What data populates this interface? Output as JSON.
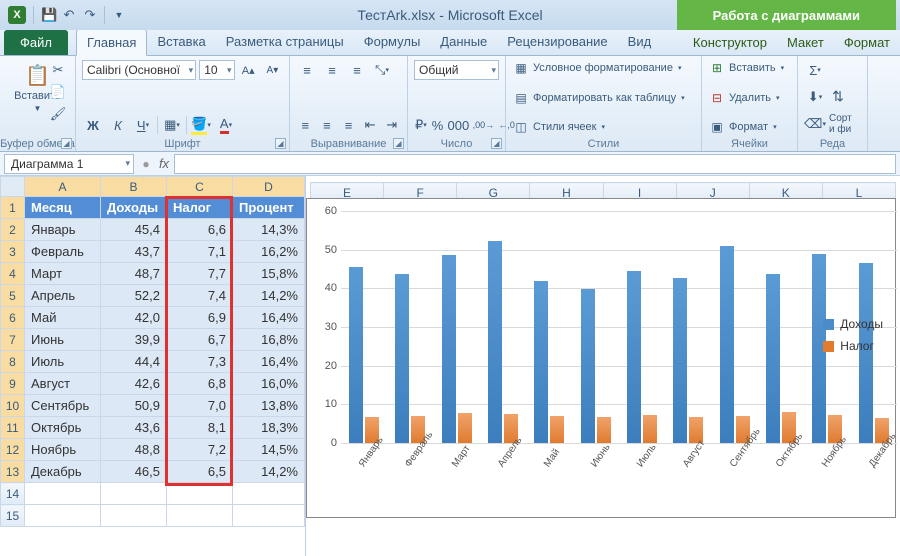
{
  "title": "ТестArk.xlsx - Microsoft Excel",
  "chart_tools_title": "Работа с диаграммами",
  "qat": {
    "save": "save",
    "undo": "undo",
    "redo": "redo"
  },
  "tabs": {
    "file": "Файл",
    "list": [
      "Главная",
      "Вставка",
      "Разметка страницы",
      "Формулы",
      "Данные",
      "Рецензирование",
      "Вид"
    ],
    "chart": [
      "Конструктор",
      "Макет",
      "Формат"
    ],
    "active": 0
  },
  "ribbon": {
    "clipboard": {
      "label": "Буфер обмена",
      "paste": "Вставить"
    },
    "font": {
      "label": "Шрифт",
      "name": "Calibri (Основної",
      "size": "10"
    },
    "align": {
      "label": "Выравнивание"
    },
    "number": {
      "label": "Число",
      "format": "Общий"
    },
    "styles": {
      "label": "Стили",
      "cond": "Условное форматирование",
      "table": "Форматировать как таблицу",
      "cell": "Стили ячеек"
    },
    "cells": {
      "label": "Ячейки",
      "insert": "Вставить",
      "delete": "Удалить",
      "format": "Формат"
    },
    "editing": {
      "label": "Реда",
      "sort": "Сорт\nи фи"
    }
  },
  "namebox": "Диаграмма 1",
  "columns": [
    "A",
    "B",
    "C",
    "D",
    "E",
    "F",
    "G",
    "H",
    "I",
    "J",
    "K",
    "L"
  ],
  "headers": {
    "A": "Месяц",
    "B": "Доходы",
    "C": "Налог",
    "D": "Процент"
  },
  "rows": [
    {
      "m": "Январь",
      "d": "45,4",
      "t": "6,6",
      "p": "14,3%"
    },
    {
      "m": "Февраль",
      "d": "43,7",
      "t": "7,1",
      "p": "16,2%"
    },
    {
      "m": "Март",
      "d": "48,7",
      "t": "7,7",
      "p": "15,8%"
    },
    {
      "m": "Апрель",
      "d": "52,2",
      "t": "7,4",
      "p": "14,2%"
    },
    {
      "m": "Май",
      "d": "42,0",
      "t": "6,9",
      "p": "16,4%"
    },
    {
      "m": "Июнь",
      "d": "39,9",
      "t": "6,7",
      "p": "16,8%"
    },
    {
      "m": "Июль",
      "d": "44,4",
      "t": "7,3",
      "p": "16,4%"
    },
    {
      "m": "Август",
      "d": "42,6",
      "t": "6,8",
      "p": "16,0%"
    },
    {
      "m": "Сентябрь",
      "d": "50,9",
      "t": "7,0",
      "p": "13,8%"
    },
    {
      "m": "Октябрь",
      "d": "43,6",
      "t": "8,1",
      "p": "18,3%"
    },
    {
      "m": "Ноябрь",
      "d": "48,8",
      "t": "7,2",
      "p": "14,5%"
    },
    {
      "m": "Декабрь",
      "d": "46,5",
      "t": "6,5",
      "p": "14,2%"
    }
  ],
  "chart_data": {
    "type": "bar",
    "categories": [
      "Январь",
      "Февраль",
      "Март",
      "Апрель",
      "Май",
      "Июнь",
      "Июль",
      "Август",
      "Сентябрь",
      "Октябрь",
      "Ноябрь",
      "Декабрь"
    ],
    "series": [
      {
        "name": "Доходы",
        "color": "#4a8bc9",
        "values": [
          45.4,
          43.7,
          48.7,
          52.2,
          42.0,
          39.9,
          44.4,
          42.6,
          50.9,
          43.6,
          48.8,
          46.5
        ]
      },
      {
        "name": "Налог",
        "color": "#e07b30",
        "values": [
          6.6,
          7.1,
          7.7,
          7.4,
          6.9,
          6.7,
          7.3,
          6.8,
          7.0,
          8.1,
          7.2,
          6.5
        ]
      }
    ],
    "ylim": [
      0,
      60
    ],
    "yticks": [
      0,
      10,
      20,
      30,
      40,
      50,
      60
    ]
  }
}
